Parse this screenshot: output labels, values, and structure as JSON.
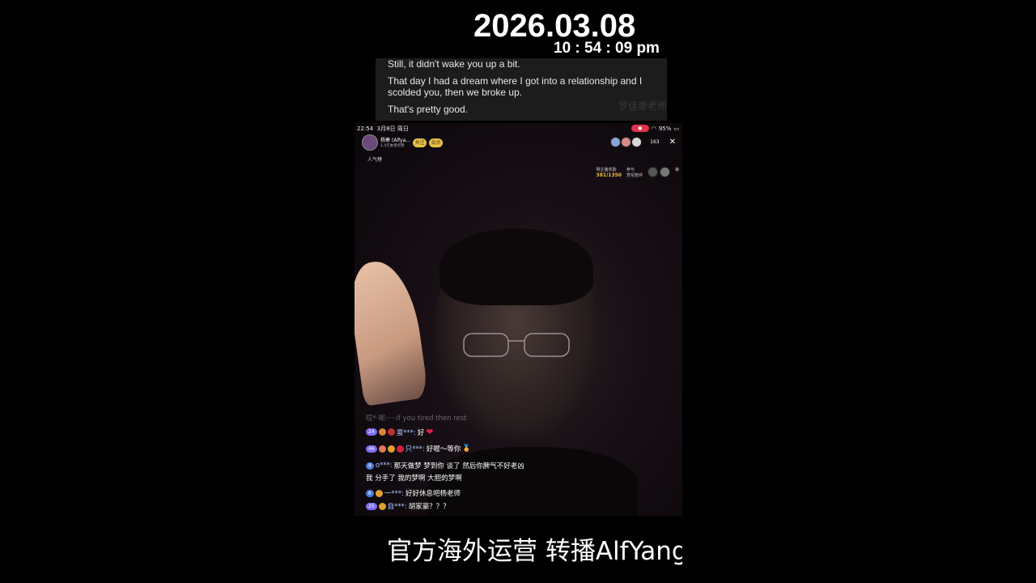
{
  "overlay": {
    "date": "2026.03.08",
    "time": "10 : 54 : 09 pm"
  },
  "translation": {
    "lines": [
      "Still, it didn't wake you up a bit.",
      "That day I had a dream where I got into a relationship and I",
      "scolded you, then we broke up.",
      "That's pretty good."
    ],
    "watermark": "罗佳豪老师"
  },
  "phone": {
    "status_time": "22:54",
    "status_date": "3月8日 周日",
    "battery": "95%",
    "host_name": "杨寒 (Alfya...",
    "host_sub": "1.4万本场点赞",
    "badge_follow": "关注",
    "badge_gift": "会员",
    "rank_label": "人气榜",
    "viewer_count": "163",
    "close_label": "✕",
    "pk_title": "明主播奖励",
    "pk_score": "381/1350",
    "pk_label2": "参与",
    "pk_label3": "赏花陪伴",
    "pk_label4": "第"
  },
  "chat": {
    "faded_line": "哎*·呢·····if you tired then rest",
    "messages": [
      {
        "level": "24",
        "user": "蛋***:",
        "text": "好"
      },
      {
        "level": "46",
        "user": "只***:",
        "text": "好喔～等你"
      },
      {
        "level": "9",
        "user": "o***:",
        "text": "那天做梦 梦到你 谈了 然后你脾气不好老凶"
      },
      {
        "level": "",
        "user": "",
        "text": "我 分手了  我的梦啊 大胆的梦啊"
      },
      {
        "level": "6",
        "user": "一***:",
        "text": "好好休息吧杨老师"
      },
      {
        "level": "25",
        "user": "自***:",
        "text": "胡家豪？？？"
      }
    ]
  },
  "footer": {
    "subtitle": "官方海外运营 转播AlfYang"
  }
}
